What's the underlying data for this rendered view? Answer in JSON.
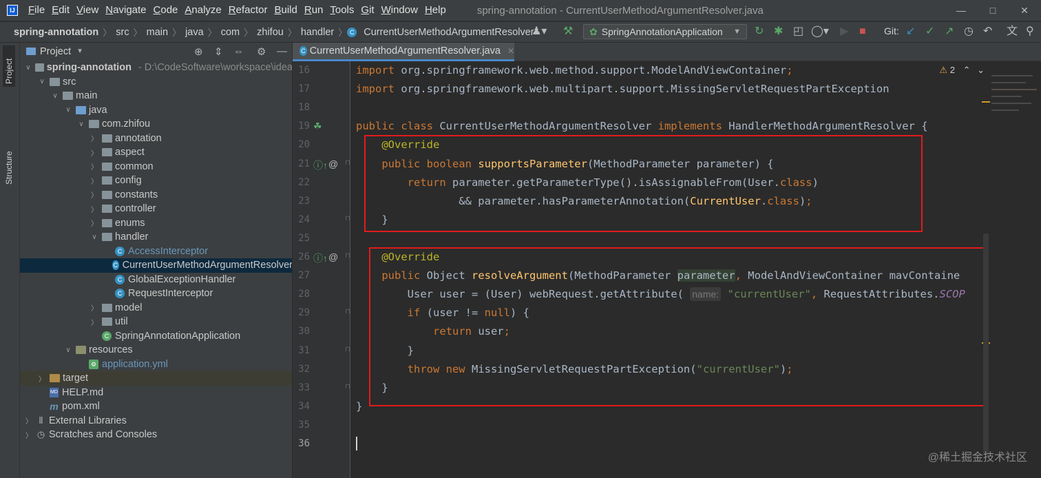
{
  "menu": {
    "items": [
      "File",
      "Edit",
      "View",
      "Navigate",
      "Code",
      "Analyze",
      "Refactor",
      "Build",
      "Run",
      "Tools",
      "Git",
      "Window",
      "Help"
    ],
    "window_title": "spring-annotation - CurrentUserMethodArgumentResolver.java"
  },
  "breadcrumb": {
    "items": [
      "spring-annotation",
      "src",
      "main",
      "java",
      "com",
      "zhifou",
      "handler",
      "CurrentUserMethodArgumentResolver"
    ]
  },
  "toolbar": {
    "run_config": "SpringAnnotationApplication",
    "git_label": "Git:"
  },
  "left_stripe": {
    "project_tab": "Project",
    "structure_tab": "Structure"
  },
  "project_panel": {
    "title": "Project",
    "tree": [
      {
        "label": "spring-annotation",
        "path": "- D:\\CodeSoftware\\workspace\\idea",
        "depth": 0,
        "arrow": "open",
        "icon": "module-folder",
        "bold": true
      },
      {
        "label": "src",
        "depth": 1,
        "arrow": "open",
        "icon": "folder"
      },
      {
        "label": "main",
        "depth": 2,
        "arrow": "open",
        "icon": "folder"
      },
      {
        "label": "java",
        "depth": 3,
        "arrow": "open",
        "icon": "source-folder"
      },
      {
        "label": "com.zhifou",
        "depth": 4,
        "arrow": "open",
        "icon": "package"
      },
      {
        "label": "annotation",
        "depth": 5,
        "arrow": "closed",
        "icon": "package"
      },
      {
        "label": "aspect",
        "depth": 5,
        "arrow": "closed",
        "icon": "package"
      },
      {
        "label": "common",
        "depth": 5,
        "arrow": "closed",
        "icon": "package"
      },
      {
        "label": "config",
        "depth": 5,
        "arrow": "closed",
        "icon": "package"
      },
      {
        "label": "constants",
        "depth": 5,
        "arrow": "closed",
        "icon": "package"
      },
      {
        "label": "controller",
        "depth": 5,
        "arrow": "closed",
        "icon": "package"
      },
      {
        "label": "enums",
        "depth": 5,
        "arrow": "closed",
        "icon": "package"
      },
      {
        "label": "handler",
        "depth": 5,
        "arrow": "open",
        "icon": "package"
      },
      {
        "label": "AccessInterceptor",
        "depth": 6,
        "arrow": "none",
        "icon": "class",
        "color": "blue"
      },
      {
        "label": "CurrentUserMethodArgumentResolver",
        "depth": 6,
        "arrow": "none",
        "icon": "class",
        "selected": true
      },
      {
        "label": "GlobalExceptionHandler",
        "depth": 6,
        "arrow": "none",
        "icon": "class"
      },
      {
        "label": "RequestInterceptor",
        "depth": 6,
        "arrow": "none",
        "icon": "class"
      },
      {
        "label": "model",
        "depth": 5,
        "arrow": "closed",
        "icon": "package"
      },
      {
        "label": "util",
        "depth": 5,
        "arrow": "closed",
        "icon": "package"
      },
      {
        "label": "SpringAnnotationApplication",
        "depth": 5,
        "arrow": "none",
        "icon": "spring-class"
      },
      {
        "label": "resources",
        "depth": 3,
        "arrow": "open",
        "icon": "resource-folder"
      },
      {
        "label": "application.yml",
        "depth": 4,
        "arrow": "none",
        "icon": "yml",
        "color": "blue"
      },
      {
        "label": "target",
        "depth": 1,
        "arrow": "closed",
        "icon": "excluded-folder",
        "target": true
      },
      {
        "label": "HELP.md",
        "depth": 1,
        "arrow": "none",
        "icon": "md"
      },
      {
        "label": "pom.xml",
        "depth": 1,
        "arrow": "none",
        "icon": "maven"
      },
      {
        "label": "External Libraries",
        "depth": 0,
        "arrow": "closed",
        "icon": "libraries"
      },
      {
        "label": "Scratches and Consoles",
        "depth": 0,
        "arrow": "closed",
        "icon": "scratches"
      }
    ]
  },
  "editor": {
    "tab_label": "CurrentUserMethodArgumentResolver.java",
    "warning_count": "2",
    "lines": [
      {
        "num": "16",
        "html": "<span class=\"kw\">import </span>org.springframework.web.method.support.ModelAndViewContainer<span class=\"kw\">;</span>"
      },
      {
        "num": "17",
        "html": "<span class=\"kw\">import </span>org.springframework.web.multipart.support.MissingServletRequestPartException"
      },
      {
        "num": "18",
        "html": ""
      },
      {
        "num": "19",
        "html": "<span class=\"kw\">public class </span>CurrentUserMethodArgumentResolver <span class=\"kw\">implements </span>HandlerMethodArgumentResolver {"
      },
      {
        "num": "20",
        "html": "    <span class=\"ann\">@Override</span>"
      },
      {
        "num": "21",
        "html": "    <span class=\"kw\">public boolean </span><span class=\"fn\">supportsParameter</span>(MethodParameter parameter) {"
      },
      {
        "num": "22",
        "html": "        <span class=\"kw\">return </span>parameter.getParameterType().isAssignableFrom(User.<span class=\"kw\">class</span>)"
      },
      {
        "num": "23",
        "html": "                &amp;&amp; parameter.hasParameterAnnotation(<span class=\"fn\">CurrentUser</span>.<span class=\"kw\">class</span>)<span class=\"kw\">;</span>"
      },
      {
        "num": "24",
        "html": "    }"
      },
      {
        "num": "25",
        "html": ""
      },
      {
        "num": "26",
        "html": "    <span class=\"ann\">@Override</span>"
      },
      {
        "num": "27",
        "html": "    <span class=\"kw\">public </span>Object <span class=\"fn\">resolveArgument</span>(MethodParameter <span class=\"param-hl\">parameter</span><span class=\"kw\">, </span>ModelAndViewContainer mavContaine"
      },
      {
        "num": "28",
        "html": "        User user = (User) webRequest.getAttribute( <span class=\"hint\">name:</span> <span class=\"str\">\"currentUser\"</span><span class=\"kw\">, </span>RequestAttributes.<span class=\"const\">SCOP</span>"
      },
      {
        "num": "29",
        "html": "        <span class=\"kw\">if </span>(user != <span class=\"kw\">null</span>) {"
      },
      {
        "num": "30",
        "html": "            <span class=\"kw\">return </span>user<span class=\"kw\">;</span>"
      },
      {
        "num": "31",
        "html": "        }"
      },
      {
        "num": "32",
        "html": "        <span class=\"kw\">throw new </span>MissingServletRequestPartException(<span class=\"str\">\"currentUser\"</span>)<span class=\"kw\">;</span>"
      },
      {
        "num": "33",
        "html": "    }"
      },
      {
        "num": "34",
        "html": "}"
      },
      {
        "num": "35",
        "html": ""
      },
      {
        "num": "36",
        "html": ""
      }
    ]
  },
  "watermark": "@稀土掘金技术社区",
  "colors": {
    "keyword": "#cc7832",
    "function": "#ffc66d",
    "annotation": "#bbb529",
    "string": "#6a8759",
    "highlight_box": "#e31b1b",
    "selection": "#0d293e"
  }
}
